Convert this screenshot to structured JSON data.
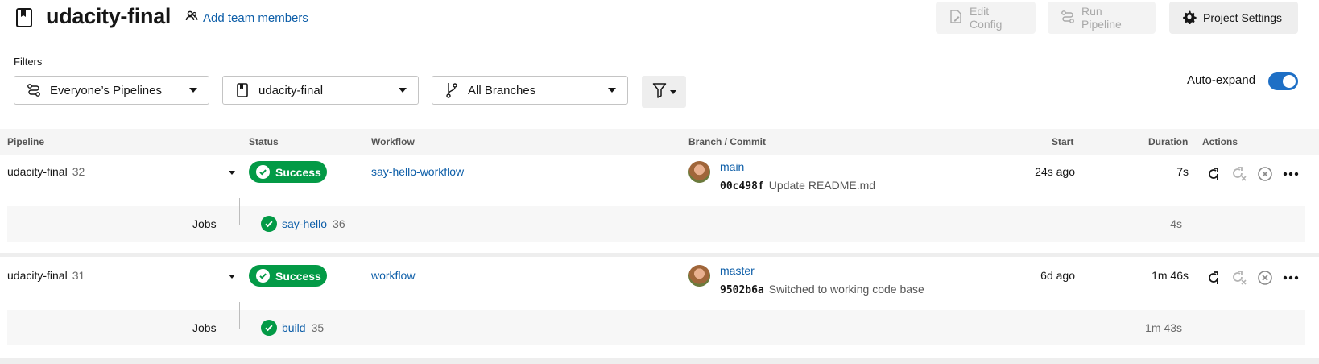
{
  "header": {
    "project_name": "udacity-final",
    "add_team_label": "Add team members",
    "edit_config_label": "Edit Config",
    "run_pipeline_label": "Run Pipeline",
    "project_settings_label": "Project Settings"
  },
  "filters": {
    "label": "Filters",
    "pipelines": "Everyone’s Pipelines",
    "project": "udacity-final",
    "branches": "All Branches",
    "auto_expand_label": "Auto-expand",
    "auto_expand_on": true
  },
  "table": {
    "headers": {
      "pipeline": "Pipeline",
      "status": "Status",
      "workflow": "Workflow",
      "branch_commit": "Branch / Commit",
      "start": "Start",
      "duration": "Duration",
      "actions": "Actions"
    },
    "jobs_label": "Jobs",
    "rows": [
      {
        "pipeline": "udacity-final",
        "number": "32",
        "status": "Success",
        "workflow": "say-hello-workflow",
        "branch": "main",
        "sha": "00c498f",
        "commit_message": "Update README.md",
        "start": "24s ago",
        "duration": "7s",
        "job_name": "say-hello",
        "job_number": "36",
        "job_duration": "4s"
      },
      {
        "pipeline": "udacity-final",
        "number": "31",
        "status": "Success",
        "workflow": "workflow",
        "branch": "master",
        "sha": "9502b6a",
        "commit_message": "Switched to working code base",
        "start": "6d ago",
        "duration": "1m 46s",
        "job_name": "build",
        "job_number": "35",
        "job_duration": "1m 43s"
      }
    ]
  },
  "colors": {
    "success": "#039a46",
    "link": "#0d5ea8",
    "toggle": "#1e6fc5"
  },
  "icons": [
    "project-book-icon",
    "people-icon",
    "file-edit-icon",
    "pipeline-icon",
    "gear-icon",
    "filter-icon",
    "branch-icon",
    "rerun-icon",
    "rerun-failed-icon",
    "cancel-icon",
    "more-icon",
    "check-icon"
  ]
}
